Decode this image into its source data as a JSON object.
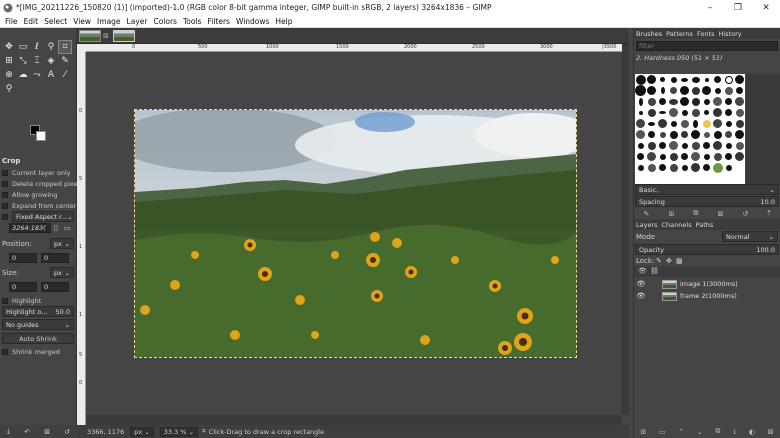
{
  "window": {
    "title": "*[IMG_20211226_150820 (1)] (imported)-1.0 (RGB color 8-bit gamma integer, GIMP built-in sRGB, 2 layers) 3264x1836 – GIMP",
    "minimize": "–",
    "maximize": "❐",
    "close": "✕"
  },
  "menu": [
    "File",
    "Edit",
    "Select",
    "View",
    "Image",
    "Layer",
    "Colors",
    "Tools",
    "Filters",
    "Windows",
    "Help"
  ],
  "tools": [
    {
      "icon": "move-icon",
      "glyph": "✥"
    },
    {
      "icon": "rect-select-icon",
      "glyph": "▭"
    },
    {
      "icon": "lasso-icon",
      "glyph": "ℓ"
    },
    {
      "icon": "fuzzy-select-icon",
      "glyph": "⚲"
    },
    {
      "icon": "crop-icon",
      "glyph": "⌗"
    },
    {
      "icon": "transform-icon",
      "glyph": "⊞"
    },
    {
      "icon": "warp-icon",
      "glyph": "⤡"
    },
    {
      "icon": "text-icon",
      "glyph": "⌶"
    },
    {
      "icon": "bucket-icon",
      "glyph": "◈"
    },
    {
      "icon": "paintbrush-icon",
      "glyph": "✎"
    },
    {
      "icon": "clone-icon",
      "glyph": "⊕"
    },
    {
      "icon": "smudge-icon",
      "glyph": "☁"
    },
    {
      "icon": "paths-icon",
      "glyph": "⤳"
    },
    {
      "icon": "font-icon",
      "glyph": "A"
    },
    {
      "icon": "color-picker-icon",
      "glyph": "⁄"
    },
    {
      "icon": "zoom-icon",
      "glyph": "⚲"
    }
  ],
  "tool_options": {
    "title": "Crop",
    "current_layer_only": "Current layer only",
    "delete_cropped_pixels": "Delete cropped pixels",
    "allow_growing": "Allow growing",
    "expand_from_center": "Expand from center",
    "fixed_aspect": "Fixed Aspect r...",
    "ratio_value": "3264:183(",
    "position_label": "Position:",
    "position_unit": "px",
    "position_x": "0",
    "position_y": "0",
    "size_label": "Size:",
    "size_unit": "px",
    "size_w": "0",
    "size_h": "0",
    "highlight": "Highlight",
    "highlight_opacity_label": "Highlight o...",
    "highlight_opacity_value": "50.0",
    "guides": "No guides",
    "auto_shrink": "Auto Shrink",
    "shrink_merged": "Shrink merged"
  },
  "ruler": {
    "top": [
      "0",
      "500",
      "1000",
      "1500",
      "2000",
      "2500",
      "3000",
      "|3500"
    ],
    "left": [
      "0",
      "5",
      "1",
      "1",
      "5",
      "0"
    ]
  },
  "status": {
    "coords": "3366, 1176",
    "unit": "px",
    "zoom": "33.3 %",
    "message": "Click-Drag to draw a crop rectangle"
  },
  "dock": {
    "tabs_top": [
      "Brushes",
      "Patterns",
      "Fonts",
      "History"
    ],
    "filter_placeholder": "filter",
    "brush_name": "2. Hardness 050 (51 × 51)",
    "preset": "Basic,",
    "spacing_label": "Spacing",
    "spacing_value": "10.0",
    "tabs_mid": [
      "Layers",
      "Channels",
      "Paths"
    ],
    "mode_label": "Mode",
    "mode_value": "Normal",
    "opacity_label": "Opacity",
    "opacity_value": "100.0",
    "lock_label": "Lock:",
    "layers": [
      {
        "name": "image 1(3000ms)"
      },
      {
        "name": "frame 2(1000ms)"
      }
    ]
  }
}
